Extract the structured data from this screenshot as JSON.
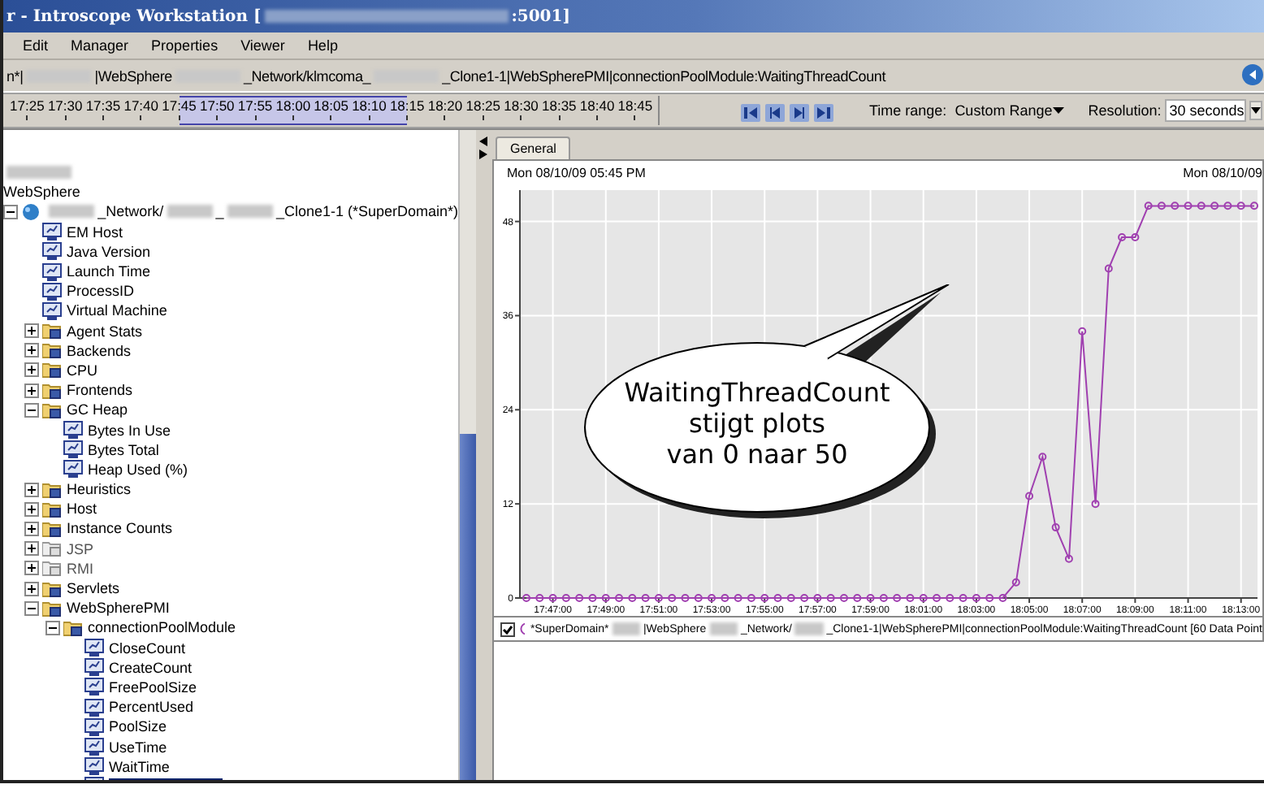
{
  "window": {
    "title_parts": [
      {
        "kind": "text",
        "text": "r - Introscope Workstation ["
      },
      {
        "kind": "redacted"
      },
      {
        "kind": "text",
        "text": ":5001]"
      }
    ]
  },
  "menu": [
    "Edit",
    "Manager",
    "Properties",
    "Viewer",
    "Help"
  ],
  "path_bar": {
    "parts": [
      {
        "kind": "text",
        "text": "n*|"
      },
      {
        "kind": "redacted"
      },
      {
        "kind": "text",
        "text": "|WebSphere"
      },
      {
        "kind": "redacted"
      },
      {
        "kind": "text",
        "text": "_Network/klmcoma_"
      },
      {
        "kind": "redacted"
      },
      {
        "kind": "text",
        "text": "_Clone1-1|WebSpherePMI|connectionPoolModule:WaitingThreadCount"
      }
    ]
  },
  "timeline": [
    {
      "label": "17:25",
      "selected": false
    },
    {
      "label": "17:30",
      "selected": false
    },
    {
      "label": "17:35",
      "selected": false
    },
    {
      "label": "17:40",
      "selected": false
    },
    {
      "label": "17:45",
      "selected": true
    },
    {
      "label": "17:50",
      "selected": true
    },
    {
      "label": "17:55",
      "selected": true
    },
    {
      "label": "18:00",
      "selected": true
    },
    {
      "label": "18:05",
      "selected": true
    },
    {
      "label": "18:10",
      "selected": true
    },
    {
      "label": "18:15",
      "selected": true
    },
    {
      "label": "18:20",
      "selected": false
    },
    {
      "label": "18:25",
      "selected": false
    },
    {
      "label": "18:30",
      "selected": false
    },
    {
      "label": "18:35",
      "selected": false
    },
    {
      "label": "18:40",
      "selected": false
    },
    {
      "label": "18:45",
      "selected": false
    }
  ],
  "nav_buttons": [
    {
      "kind": "first"
    },
    {
      "kind": "prev"
    },
    {
      "kind": "next"
    },
    {
      "kind": "last"
    }
  ],
  "time_range": {
    "label": "Time range:",
    "value": "Custom Range"
  },
  "resolution": {
    "label": "Resolution:",
    "value": "30 seconds"
  },
  "tree": [
    {
      "kind": "redacted"
    },
    {
      "kind": "text",
      "label": "WebSphere"
    },
    {
      "kind": "agent",
      "parts": [
        {
          "kind": "redacted"
        },
        {
          "kind": "text",
          "text": "_Network/"
        },
        {
          "kind": "redacted"
        },
        {
          "kind": "text",
          "text": "_"
        },
        {
          "kind": "redacted"
        },
        {
          "kind": "text",
          "text": "_Clone1-1 (*SuperDomain*)"
        }
      ],
      "expanded": true,
      "children": [
        {
          "kind": "metric",
          "label": "EM Host"
        },
        {
          "kind": "metric",
          "label": "Java Version"
        },
        {
          "kind": "metric",
          "label": "Launch Time"
        },
        {
          "kind": "metric",
          "label": "ProcessID"
        },
        {
          "kind": "metric",
          "label": "Virtual Machine"
        },
        {
          "kind": "folder",
          "label": "Agent Stats",
          "expanded": false
        },
        {
          "kind": "folder",
          "label": "Backends",
          "expanded": false
        },
        {
          "kind": "folder",
          "label": "CPU",
          "expanded": false
        },
        {
          "kind": "folder",
          "label": "Frontends",
          "expanded": false
        },
        {
          "kind": "folder",
          "label": "GC Heap",
          "expanded": true,
          "children": [
            {
              "kind": "metric",
              "label": "Bytes In Use"
            },
            {
              "kind": "metric",
              "label": "Bytes Total"
            },
            {
              "kind": "metric",
              "label": "Heap Used (%)"
            }
          ]
        },
        {
          "kind": "folder",
          "label": "Heuristics",
          "expanded": false
        },
        {
          "kind": "folder",
          "label": "Host",
          "expanded": false
        },
        {
          "kind": "folder",
          "label": "Instance Counts",
          "expanded": false
        },
        {
          "kind": "folder",
          "label": "JSP",
          "expanded": false,
          "disabled": true
        },
        {
          "kind": "folder",
          "label": "RMI",
          "expanded": false,
          "disabled": true
        },
        {
          "kind": "folder",
          "label": "Servlets",
          "expanded": false
        },
        {
          "kind": "folder",
          "label": "WebSpherePMI",
          "expanded": true,
          "children": [
            {
              "kind": "folder",
              "label": "connectionPoolModule",
              "expanded": true,
              "children": [
                {
                  "kind": "metric",
                  "label": "CloseCount"
                },
                {
                  "kind": "metric",
                  "label": "CreateCount"
                },
                {
                  "kind": "metric",
                  "label": "FreePoolSize"
                },
                {
                  "kind": "metric",
                  "label": "PercentUsed"
                },
                {
                  "kind": "metric",
                  "label": "PoolSize"
                },
                {
                  "kind": "metric",
                  "label": "UseTime"
                },
                {
                  "kind": "metric",
                  "label": "WaitTime"
                },
                {
                  "kind": "metric",
                  "selected": true
                }
              ]
            }
          ]
        }
      ]
    }
  ],
  "tabs": [
    {
      "label": "General",
      "selected": true
    }
  ],
  "chart": {
    "header_left": "Mon 08/10/09 05:45 PM",
    "header_right": "Mon 08/10/09",
    "chart_data": {
      "type": "line",
      "categories": [
        null,
        null,
        "17:47:00",
        null,
        null,
        null,
        "17:49:00",
        null,
        null,
        null,
        "17:51:00",
        null,
        null,
        null,
        "17:53:00",
        null,
        null,
        null,
        "17:55:00",
        null,
        null,
        null,
        "17:57:00",
        null,
        null,
        null,
        "17:59:00",
        null,
        null,
        null,
        "18:01:00",
        null,
        null,
        null,
        "18:03:00",
        null,
        null,
        null,
        "18:05:00",
        null,
        null,
        null,
        "18:07:00",
        null,
        null,
        null,
        "18:09:00",
        null,
        null,
        null,
        "18:11:00",
        null,
        null,
        null,
        "18:13:00",
        null
      ],
      "grid": true,
      "series": [
        {
          "color": "#a040b0",
          "marker": "circle",
          "values": [
            0,
            0,
            0,
            0,
            0,
            0,
            0,
            0,
            0,
            0,
            0,
            0,
            0,
            0,
            0,
            0,
            0,
            0,
            0,
            0,
            0,
            0,
            0,
            0,
            0,
            0,
            0,
            0,
            0,
            0,
            0,
            0,
            0,
            0,
            0,
            0,
            0,
            2,
            13,
            18,
            9,
            5,
            34,
            12,
            42,
            46,
            46,
            50,
            50,
            50,
            50,
            50,
            50,
            50,
            50,
            50
          ]
        }
      ],
      "ylim": [
        0,
        52
      ],
      "yticks": [
        0,
        12,
        24,
        36,
        48
      ]
    }
  },
  "legend": {
    "checked": true,
    "parts": [
      {
        "kind": "text",
        "text": "*SuperDomain*"
      },
      {
        "kind": "redacted"
      },
      {
        "kind": "text",
        "text": "|WebSphere"
      },
      {
        "kind": "redacted"
      },
      {
        "kind": "text",
        "text": "_Network/"
      },
      {
        "kind": "redacted"
      },
      {
        "kind": "text",
        "text": "_Clone1-1|WebSpherePMI|connectionPoolModule:WaitingThreadCount [60  Data  Point"
      }
    ]
  },
  "callout": {
    "lines": [
      "WaitingThreadCount",
      "stijgt plots",
      "van 0 naar 50"
    ]
  }
}
